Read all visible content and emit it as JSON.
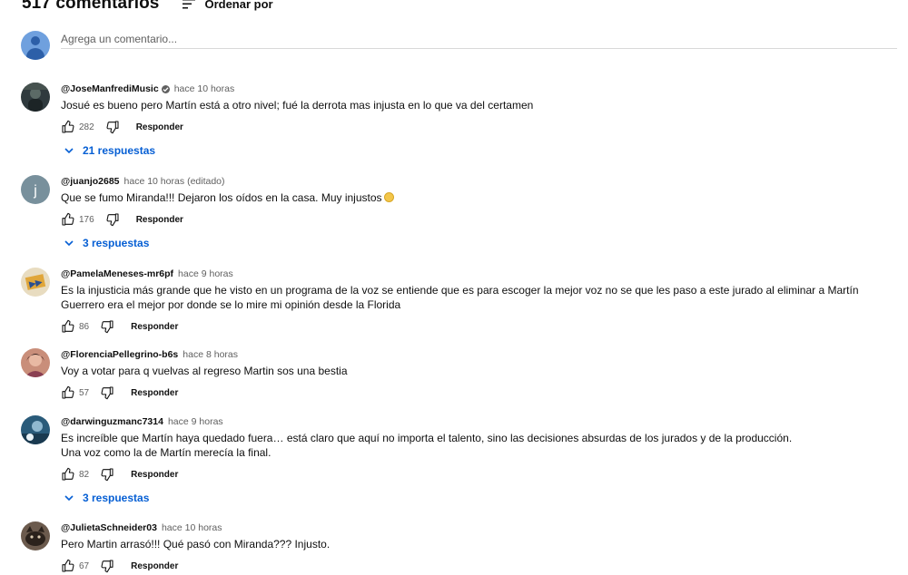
{
  "header": {
    "count": "517 comentarios",
    "sort_label": "Ordenar por"
  },
  "add_comment": {
    "placeholder": "Agrega un comentario..."
  },
  "comments": [
    {
      "author": "@JoseManfrediMusic",
      "verified": true,
      "time": "hace 10 horas",
      "text": "Josué es bueno pero Martín está a otro nivel; fué la derrota mas injusta en lo que va del certamen",
      "likes": "282",
      "reply_label": "Responder",
      "replies_label": "21 respuestas"
    },
    {
      "author": "@juanjo2685",
      "time": "hace 10 horas",
      "edited": "(editado)",
      "text": "Que se fumo Miranda!!! Dejaron los oídos en la casa. Muy injustos",
      "likes": "176",
      "reply_label": "Responder",
      "replies_label": "3 respuestas"
    },
    {
      "author": "@PamelaMeneses-mr6pf",
      "time": "hace 9 horas",
      "text": "Es la injusticia más grande que he visto en un programa de la voz se entiende que es para escoger la mejor voz no se que les paso a este jurado al eliminar a Martín Guerrero era el mejor por donde se lo mire mi opinión desde la Florida",
      "likes": "86",
      "reply_label": "Responder"
    },
    {
      "author": "@FlorenciaPellegrino-b6s",
      "time": "hace 8 horas",
      "text": "Voy a votar para q vuelvas al regreso Martin sos una bestia",
      "likes": "57",
      "reply_label": "Responder"
    },
    {
      "author": "@darwinguzmanc7314",
      "time": "hace 9 horas",
      "text": "Es increíble que Martín haya quedado fuera… está claro que aquí no importa el talento, sino las decisiones absurdas de los jurados y de la producción.\nUna voz como la de Martín merecía la final.",
      "likes": "82",
      "reply_label": "Responder",
      "replies_label": "3 respuestas"
    },
    {
      "author": "@JulietaSchneider03",
      "time": "hace 10 horas",
      "text": "Pero  Martin arrasó!!! Qué pasó con Miranda??? Injusto.",
      "likes": "67",
      "reply_label": "Responder"
    }
  ],
  "colors": {
    "link_blue": "#065fd4",
    "secondary_text": "#606060",
    "avatar_default": "#6fa0de"
  }
}
